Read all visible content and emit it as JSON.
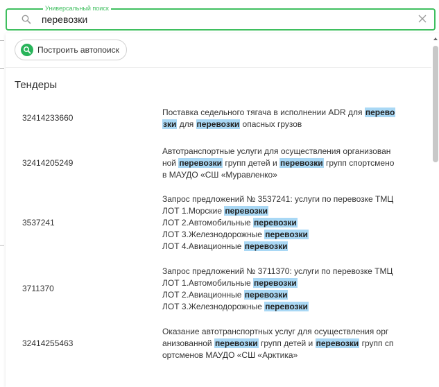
{
  "search": {
    "legend": "Универсальный поиск",
    "value": "перевозки",
    "placeholder": ""
  },
  "autosearch_button": {
    "label": "Построить автопоиск"
  },
  "section": {
    "title": "Тендеры"
  },
  "results": [
    {
      "id": "32414233660",
      "lines": [
        [
          "Поставка седельного тягача в исполнении ADR для ",
          {
            "hl": "перево"
          }
        ],
        [
          {
            "hl": "зки"
          },
          " для ",
          {
            "hl": "перевозки"
          },
          " опасных грузов"
        ]
      ]
    },
    {
      "id": "32414205249",
      "lines": [
        [
          "Автотранспортные услуги для осуществления организован"
        ],
        [
          "ной ",
          {
            "hl": "перевозки"
          },
          " групп детей и ",
          {
            "hl": "перевозки"
          },
          " групп спортсмено"
        ],
        [
          "в  МАУДО «СШ «Муравленко»"
        ]
      ]
    },
    {
      "id": "3537241",
      "lines": [
        [
          "Запрос предложений № 3537241: услуги по перевозке ТМЦ"
        ],
        [
          "ЛОТ 1.Морские ",
          {
            "hl": "перевозки"
          }
        ],
        [
          "ЛОТ 2.Автомобильные ",
          {
            "hl": "перевозки"
          }
        ],
        [
          "ЛОТ 3.Железнодорожные ",
          {
            "hl": "перевозки"
          }
        ],
        [
          "ЛОТ 4.Авиационные ",
          {
            "hl": "перевозки"
          }
        ]
      ]
    },
    {
      "id": "3711370",
      "lines": [
        [
          "Запрос предложений № 3711370: услуги по перевозке ТМЦ"
        ],
        [
          "ЛОТ 1.Автомобильные ",
          {
            "hl": "перевозки"
          }
        ],
        [
          "ЛОТ 2.Авиационные ",
          {
            "hl": "перевозки"
          }
        ],
        [
          "ЛОТ 3.Железнодорожные ",
          {
            "hl": "перевозки"
          }
        ]
      ]
    },
    {
      "id": "32414255463",
      "lines": [
        [
          "Оказание автотранспортных услуг для осуществления  орг"
        ],
        [
          "анизованной ",
          {
            "hl": "перевозки"
          },
          " групп детей и ",
          {
            "hl": "перевозки"
          },
          " групп сп"
        ],
        [
          "ортсменов  МАУДО «СШ «Арктика»"
        ]
      ]
    }
  ],
  "colors": {
    "accent": "#3fbf5f",
    "autosearch_icon": "#28b45a",
    "highlight": "#a9d8f5"
  },
  "icons": {
    "search": "search-icon",
    "clear": "close-icon",
    "autosearch": "search-icon"
  }
}
